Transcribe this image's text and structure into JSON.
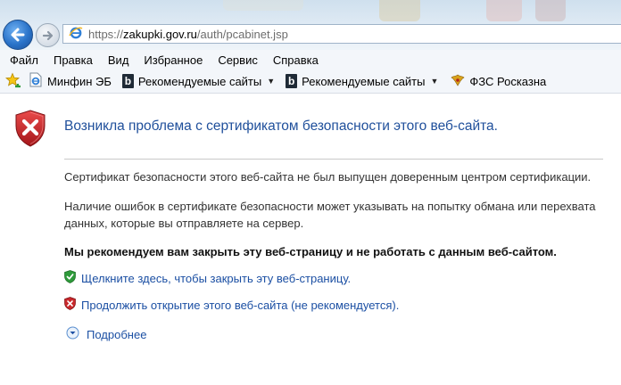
{
  "address_bar": {
    "url_prefix": "https://",
    "url_domain": "zakupki.gov.ru",
    "url_path": "/auth/pcabinet.jsp"
  },
  "menu": {
    "items": [
      "Файл",
      "Правка",
      "Вид",
      "Избранное",
      "Сервис",
      "Справка"
    ]
  },
  "favorites": {
    "items": [
      {
        "label": "Минфин ЭБ",
        "icon": "ie-page-icon"
      },
      {
        "label": "Рекомендуемые сайты",
        "icon": "bing-icon",
        "dropdown": true
      },
      {
        "label": "Рекомендуемые сайты",
        "icon": "bing-icon",
        "dropdown": true
      },
      {
        "label": "ФЗС Росказна",
        "icon": "eagle-emblem-icon"
      }
    ]
  },
  "error_page": {
    "title": "Возникла проблема с сертификатом безопасности этого веб-сайта.",
    "paragraph1": "Сертификат безопасности этого веб-сайта не был выпущен доверенным центром сертификации.",
    "paragraph2": "Наличие ошибок в сертификате безопасности может указывать на попытку обмана или перехвата данных, которые вы отправляете на сервер.",
    "recommendation": "Мы рекомендуем вам закрыть эту веб-страницу и не работать с данным веб-сайтом.",
    "close_link": "Щелкните здесь, чтобы закрыть эту веб-страницу.",
    "continue_link": "Продолжить открытие этого веб-сайта (не рекомендуется).",
    "more_info": "Подробнее"
  },
  "colors": {
    "title_blue": "#1f4f9b",
    "link_blue": "#1b4fa3",
    "shield_red": "#c8282c",
    "safe_green": "#2e9a3a"
  }
}
